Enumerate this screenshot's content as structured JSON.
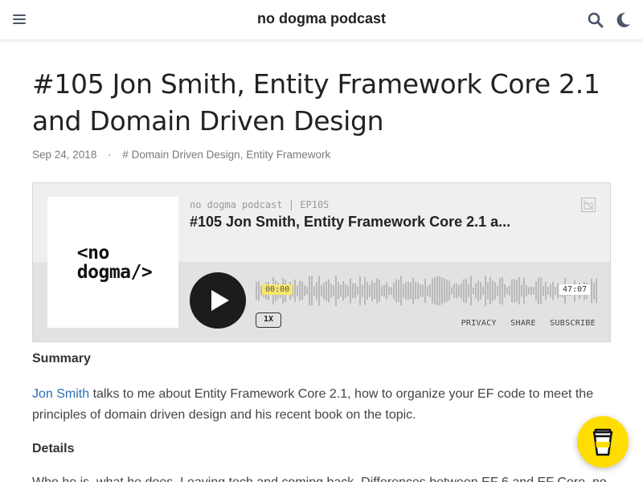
{
  "header": {
    "site_title": "no dogma podcast",
    "menu_icon": "hamburger-menu-icon",
    "search_icon": "search-icon",
    "theme_icon": "moon-icon"
  },
  "post": {
    "title": "#105 Jon Smith, Entity Framework Core 2.1 and Domain Driven Design",
    "date": "Sep 24, 2018",
    "separator": "·",
    "tags_prefix": "#",
    "tags": "Domain Driven Design, Entity Framework"
  },
  "player": {
    "cover_text_line1": "<no",
    "cover_text_line2": "dogma/>",
    "meta": "no dogma podcast | EP105",
    "episode_title": "#105 Jon Smith, Entity Framework Core 2.1 a...",
    "current_time": "00:00",
    "total_time": "47:07",
    "speed": "1X",
    "links": {
      "privacy": "PRIVACY",
      "share": "SHARE",
      "subscribe": "SUBSCRIBE"
    },
    "progress": 0,
    "colors": {
      "accent": "#f5e66b",
      "play": "#1c1c1c",
      "background": "#e2e2e2"
    }
  },
  "content": {
    "summary_heading": "Summary",
    "summary_link": "Jon Smith",
    "summary_text": " talks to me about Entity Framework Core 2.1, how to organize your EF code to meet the principles of domain driven design and his recent book on the topic.",
    "details_heading": "Details",
    "details_text": "Who he is, what he does. Leaving tech and coming back. Differences between EF 6 and EF Core, no"
  },
  "floating": {
    "button_icon": "coffee-cup-icon",
    "color": "#ffdd00"
  }
}
